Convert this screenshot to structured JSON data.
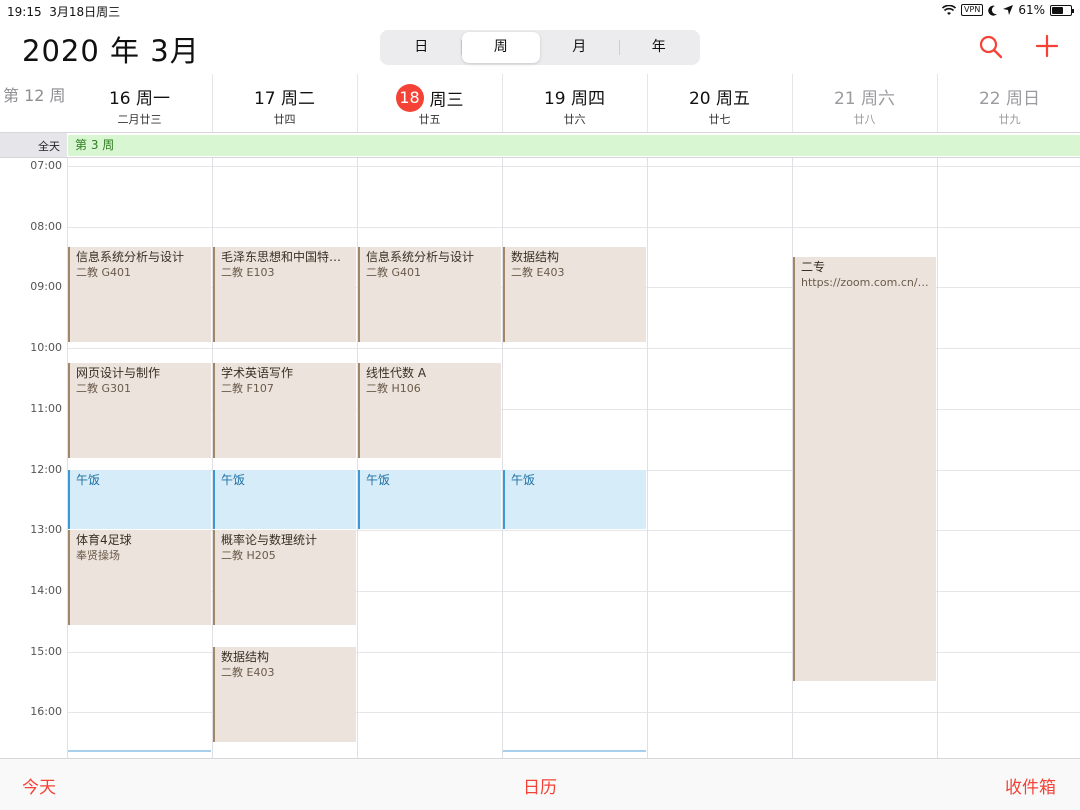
{
  "status": {
    "time": "19:15",
    "date": "3月18日周三",
    "vpn": "VPN",
    "battery_pct": "61%",
    "battery_level": 0.61
  },
  "header": {
    "title": "2020 年 3月",
    "segments": [
      "日",
      "周",
      "月",
      "年"
    ],
    "active_segment": "周"
  },
  "week_label": "第 12 周",
  "days": [
    {
      "name": "16 周一",
      "lunar": "二月廿三"
    },
    {
      "name": "17 周二",
      "lunar": "廿四"
    },
    {
      "num": "18",
      "name": "周三",
      "lunar": "廿五",
      "today": true
    },
    {
      "name": "19 周四",
      "lunar": "廿六"
    },
    {
      "name": "20 周五",
      "lunar": "廿七"
    },
    {
      "name": "21 周六",
      "lunar": "廿八"
    },
    {
      "name": "22 周日",
      "lunar": "廿九"
    }
  ],
  "allday": {
    "label": "全天",
    "event": "第 3 周"
  },
  "hours": [
    "07:00",
    "08:00",
    "09:00",
    "10:00",
    "11:00",
    "12:00",
    "13:00",
    "14:00",
    "15:00",
    "16:00"
  ],
  "events": [
    {
      "day": 0,
      "start": "08:20",
      "end": "09:55",
      "title": "信息系统分析与设计",
      "location": "二教 G401"
    },
    {
      "day": 0,
      "start": "10:15",
      "end": "11:50",
      "title": "网页设计与制作",
      "location": "二教 G301"
    },
    {
      "day": 0,
      "start": "12:00",
      "end": "13:00",
      "title": "午饭",
      "location": "",
      "type": "lunch"
    },
    {
      "day": 0,
      "start": "13:00",
      "end": "14:35",
      "title": "体育4足球",
      "location": "奉贤操场"
    },
    {
      "day": 1,
      "start": "08:20",
      "end": "09:55",
      "title": "毛泽东思想和中国特…",
      "location": "二教 E103"
    },
    {
      "day": 1,
      "start": "10:15",
      "end": "11:50",
      "title": "学术英语写作",
      "location": "二教 F107"
    },
    {
      "day": 1,
      "start": "12:00",
      "end": "13:00",
      "title": "午饭",
      "location": "",
      "type": "lunch"
    },
    {
      "day": 1,
      "start": "13:00",
      "end": "14:35",
      "title": "概率论与数理统计",
      "location": "二教 H205"
    },
    {
      "day": 1,
      "start": "14:55",
      "end": "16:30",
      "title": "数据结构",
      "location": "二教 E403"
    },
    {
      "day": 2,
      "start": "08:20",
      "end": "09:55",
      "title": "信息系统分析与设计",
      "location": "二教 G401"
    },
    {
      "day": 2,
      "start": "10:15",
      "end": "11:50",
      "title": "线性代数 A",
      "location": "二教 H106"
    },
    {
      "day": 2,
      "start": "12:00",
      "end": "13:00",
      "title": "午饭",
      "location": "",
      "type": "lunch"
    },
    {
      "day": 3,
      "start": "08:20",
      "end": "09:55",
      "title": "数据结构",
      "location": "二教 E403"
    },
    {
      "day": 3,
      "start": "12:00",
      "end": "13:00",
      "title": "午饭",
      "location": "",
      "type": "lunch"
    },
    {
      "day": 5,
      "start": "08:30",
      "end": "15:30",
      "title": "二专",
      "location": "https://zoom.com.cn/j/…"
    }
  ],
  "tabbar": {
    "today": "今天",
    "calendar": "日历",
    "inbox": "收件箱"
  },
  "colors": {
    "accent": "#f44336",
    "event_bg": "#ece4dc",
    "event_border": "#a2866a",
    "lunch_bg": "#d6ecf8",
    "allday_bg": "#d9f6d2"
  },
  "icons": {
    "search": "search-icon",
    "add": "plus-icon"
  }
}
